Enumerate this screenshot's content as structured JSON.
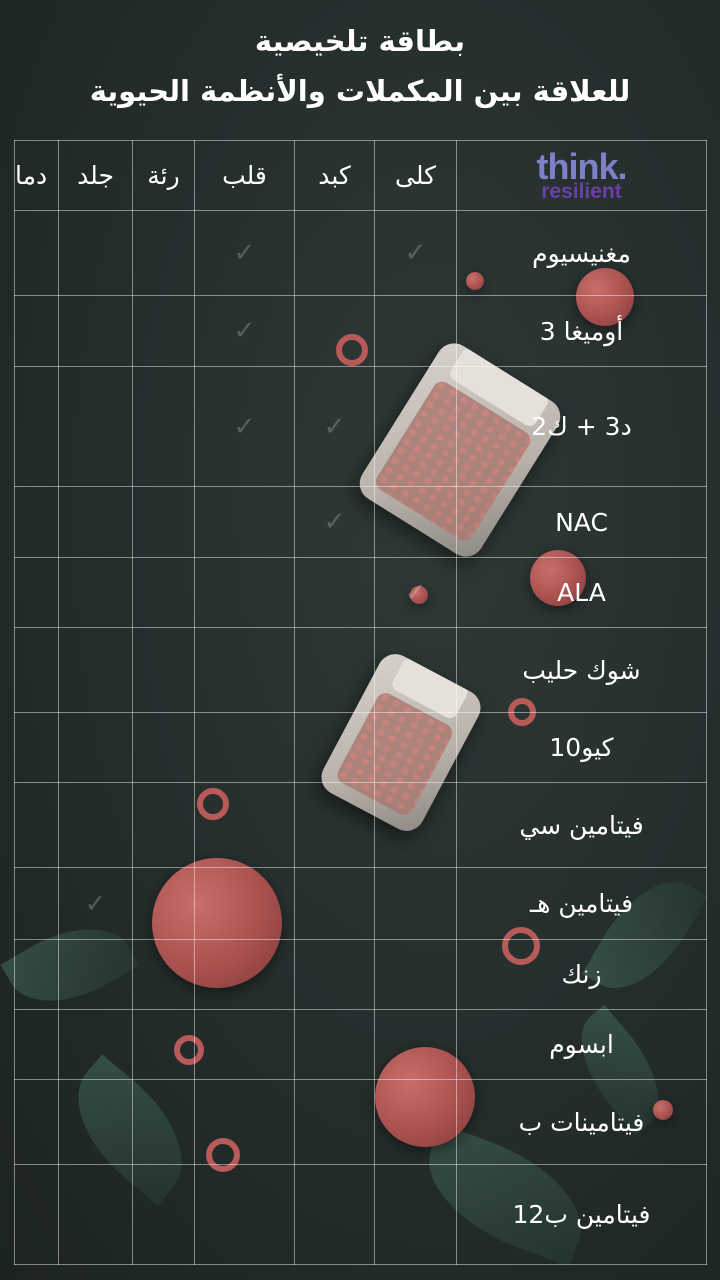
{
  "title": {
    "line1": "بطاقة تلخيصية",
    "line2": "للعلاقة بين المكملات والأنظمة الحيوية"
  },
  "logo": {
    "line1": "think.",
    "line2": "resilient"
  },
  "columns": [
    "دما",
    "جلد",
    "رئة",
    "قلب",
    "كبد",
    "كلى"
  ],
  "rows": [
    "مغنيسيوم",
    "أوميغا 3",
    "د3 + ك2",
    "NAC",
    "ALA",
    "شوك حليب",
    "كيو10",
    "فيتامين سي",
    "فيتامين هـ",
    "زنك",
    "ابسوم",
    "فيتامينات ب",
    "فيتامين ب12"
  ],
  "checkmark_symbol": "✓",
  "colors": {
    "background": "#242d2c",
    "grid_line": "#ffffff",
    "logo_think": "#7d82c8",
    "logo_resilient": "#6a3fa8",
    "accent": "#b85a57"
  }
}
